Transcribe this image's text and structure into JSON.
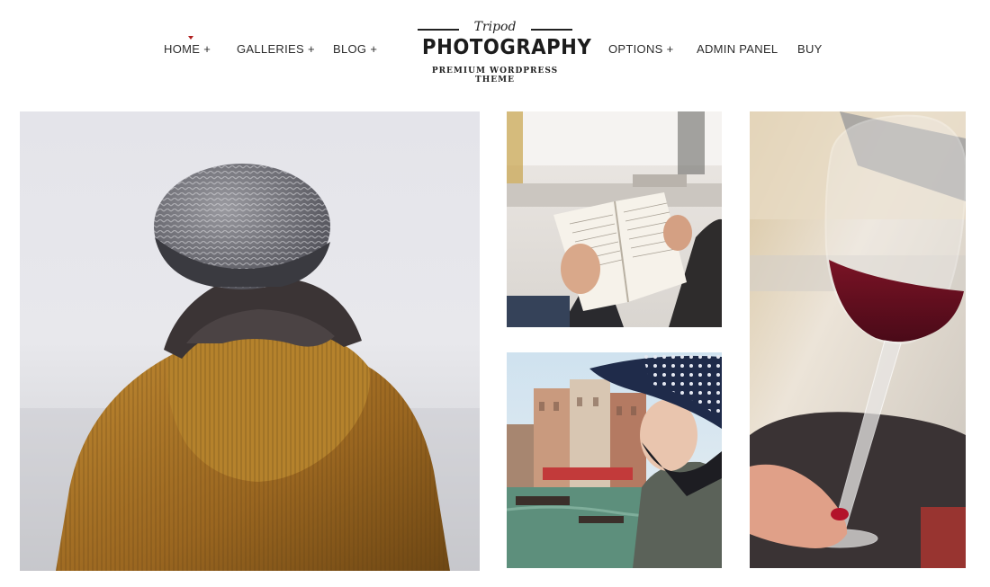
{
  "nav": {
    "left": [
      {
        "label": "HOME",
        "suffix": "+"
      },
      {
        "label": "GALLERIES",
        "suffix": "+"
      },
      {
        "label": "BLOG",
        "suffix": "+"
      }
    ],
    "right": [
      {
        "label": "OPTIONS",
        "suffix": "+"
      },
      {
        "label": "ADMIN PANEL",
        "suffix": ""
      },
      {
        "label": "BUY",
        "suffix": ""
      }
    ],
    "active_color": "#b01e1e"
  },
  "logo": {
    "script": "Tripod",
    "title": "PHOTOGRAPHY",
    "tagline": "PREMIUM WORDPRESS THEME"
  },
  "gallery": [
    {
      "subject": "person-in-knit-hat-and-mustard-corduroy-jacket"
    },
    {
      "subject": "person-reading-book"
    },
    {
      "subject": "woman-in-sun-hat-overlooking-canal"
    },
    {
      "subject": "hand-holding-red-wine-glass"
    }
  ]
}
